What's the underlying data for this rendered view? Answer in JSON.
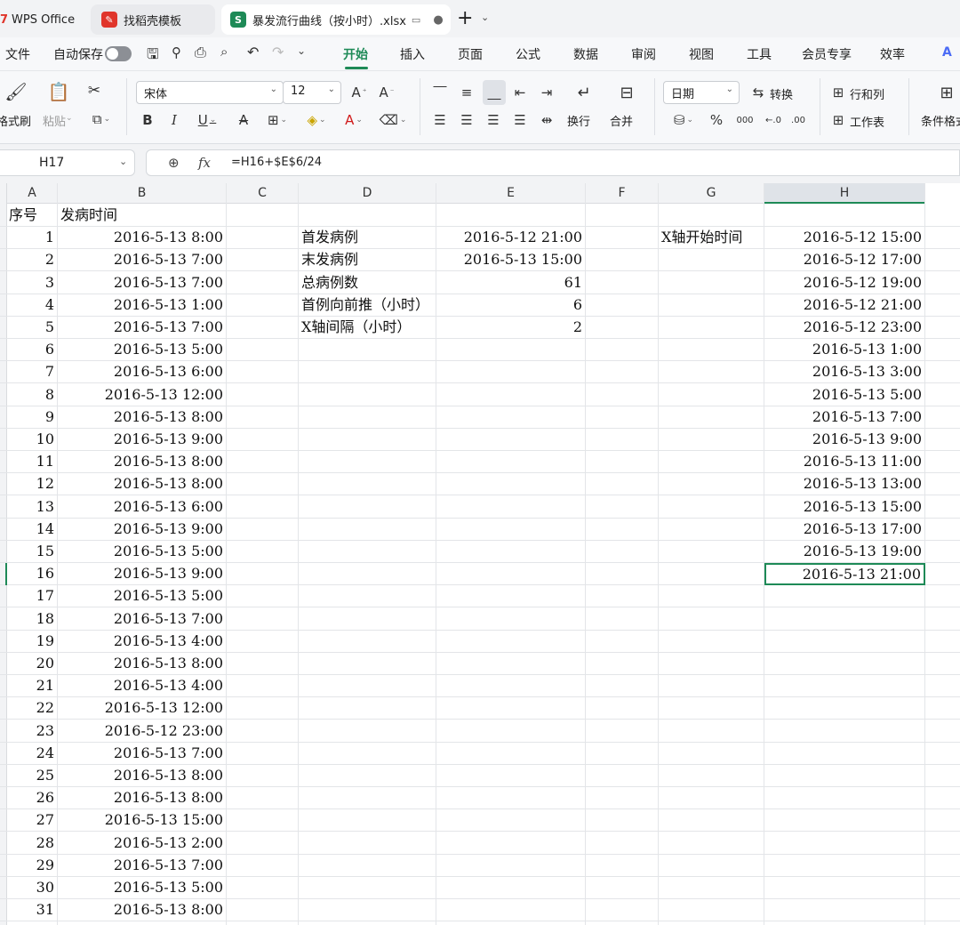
{
  "tabs": [
    {
      "label": "WPS Office",
      "icon": "wps-logo-icon"
    },
    {
      "label": "找稻壳模板",
      "icon": "docer-icon"
    },
    {
      "label": "暴发流行曲线（按小时）.xlsx",
      "icon": "spreadsheet-icon",
      "active": true
    }
  ],
  "menu": {
    "file": "文件",
    "autosave": "自动保存",
    "items": [
      "开始",
      "插入",
      "页面",
      "公式",
      "数据",
      "审阅",
      "视图",
      "工具",
      "会员专享",
      "效率"
    ],
    "active": "开始"
  },
  "ribbon": {
    "format_painter": "格式刷",
    "paste": "粘贴",
    "font_name": "宋体",
    "font_size": "12",
    "wrap": "换行",
    "merge": "合并",
    "number_format": "日期",
    "convert": "转换",
    "row_col": "行和列",
    "worksheet": "工作表",
    "cond_format": "条件格式",
    "percent": "%"
  },
  "formula_bar": {
    "name_box": "H17",
    "fx": "fx",
    "formula": "=H16+$E$6/24"
  },
  "columns": [
    "A",
    "B",
    "C",
    "D",
    "E",
    "F",
    "G",
    "H"
  ],
  "rows": [
    {
      "A": "序号",
      "B": "发病时间",
      "D": "",
      "E": "",
      "G": "",
      "H": ""
    },
    {
      "A": "1",
      "B": "2016-5-13  8:00",
      "D": "首发病例",
      "E": "2016-5-12 21:00",
      "G": "X轴开始时间",
      "H": "2016-5-12 15:00"
    },
    {
      "A": "2",
      "B": "2016-5-13  7:00",
      "D": "末发病例",
      "E": "2016-5-13 15:00",
      "G": "",
      "H": "2016-5-12 17:00"
    },
    {
      "A": "3",
      "B": "2016-5-13  7:00",
      "D": "总病例数",
      "E": "61",
      "G": "",
      "H": "2016-5-12 19:00"
    },
    {
      "A": "4",
      "B": "2016-5-13  1:00",
      "D": "首例向前推（小时）",
      "E": "6",
      "G": "",
      "H": "2016-5-12 21:00"
    },
    {
      "A": "5",
      "B": "2016-5-13  7:00",
      "D": "X轴间隔（小时）",
      "E": "2",
      "G": "",
      "H": "2016-5-12 23:00"
    },
    {
      "A": "6",
      "B": "2016-5-13  5:00",
      "D": "",
      "E": "",
      "G": "",
      "H": "2016-5-13  1:00"
    },
    {
      "A": "7",
      "B": "2016-5-13  6:00",
      "D": "",
      "E": "",
      "G": "",
      "H": "2016-5-13  3:00"
    },
    {
      "A": "8",
      "B": "2016-5-13 12:00",
      "D": "",
      "E": "",
      "G": "",
      "H": "2016-5-13  5:00"
    },
    {
      "A": "9",
      "B": "2016-5-13  8:00",
      "D": "",
      "E": "",
      "G": "",
      "H": "2016-5-13  7:00"
    },
    {
      "A": "10",
      "B": "2016-5-13  9:00",
      "D": "",
      "E": "",
      "G": "",
      "H": "2016-5-13  9:00"
    },
    {
      "A": "11",
      "B": "2016-5-13  8:00",
      "D": "",
      "E": "",
      "G": "",
      "H": "2016-5-13 11:00"
    },
    {
      "A": "12",
      "B": "2016-5-13  8:00",
      "D": "",
      "E": "",
      "G": "",
      "H": "2016-5-13 13:00"
    },
    {
      "A": "13",
      "B": "2016-5-13  6:00",
      "D": "",
      "E": "",
      "G": "",
      "H": "2016-5-13 15:00"
    },
    {
      "A": "14",
      "B": "2016-5-13  9:00",
      "D": "",
      "E": "",
      "G": "",
      "H": "2016-5-13 17:00"
    },
    {
      "A": "15",
      "B": "2016-5-13  5:00",
      "D": "",
      "E": "",
      "G": "",
      "H": "2016-5-13 19:00"
    },
    {
      "A": "16",
      "B": "2016-5-13  9:00",
      "D": "",
      "E": "",
      "G": "",
      "H": "2016-5-13 21:00"
    },
    {
      "A": "17",
      "B": "2016-5-13  5:00",
      "D": "",
      "E": "",
      "G": "",
      "H": ""
    },
    {
      "A": "18",
      "B": "2016-5-13  7:00",
      "D": "",
      "E": "",
      "G": "",
      "H": ""
    },
    {
      "A": "19",
      "B": "2016-5-13  4:00",
      "D": "",
      "E": "",
      "G": "",
      "H": ""
    },
    {
      "A": "20",
      "B": "2016-5-13  8:00",
      "D": "",
      "E": "",
      "G": "",
      "H": ""
    },
    {
      "A": "21",
      "B": "2016-5-13  4:00",
      "D": "",
      "E": "",
      "G": "",
      "H": ""
    },
    {
      "A": "22",
      "B": "2016-5-13 12:00",
      "D": "",
      "E": "",
      "G": "",
      "H": ""
    },
    {
      "A": "23",
      "B": "2016-5-12 23:00",
      "D": "",
      "E": "",
      "G": "",
      "H": ""
    },
    {
      "A": "24",
      "B": "2016-5-13  7:00",
      "D": "",
      "E": "",
      "G": "",
      "H": ""
    },
    {
      "A": "25",
      "B": "2016-5-13  8:00",
      "D": "",
      "E": "",
      "G": "",
      "H": ""
    },
    {
      "A": "26",
      "B": "2016-5-13  8:00",
      "D": "",
      "E": "",
      "G": "",
      "H": ""
    },
    {
      "A": "27",
      "B": "2016-5-13 15:00",
      "D": "",
      "E": "",
      "G": "",
      "H": ""
    },
    {
      "A": "28",
      "B": "2016-5-13  2:00",
      "D": "",
      "E": "",
      "G": "",
      "H": ""
    },
    {
      "A": "29",
      "B": "2016-5-13  7:00",
      "D": "",
      "E": "",
      "G": "",
      "H": ""
    },
    {
      "A": "30",
      "B": "2016-5-13  5:00",
      "D": "",
      "E": "",
      "G": "",
      "H": ""
    },
    {
      "A": "31",
      "B": "2016-5-13  8:00",
      "D": "",
      "E": "",
      "G": "",
      "H": ""
    }
  ],
  "selection": {
    "cell": "H17",
    "color": "#1e8a57"
  }
}
